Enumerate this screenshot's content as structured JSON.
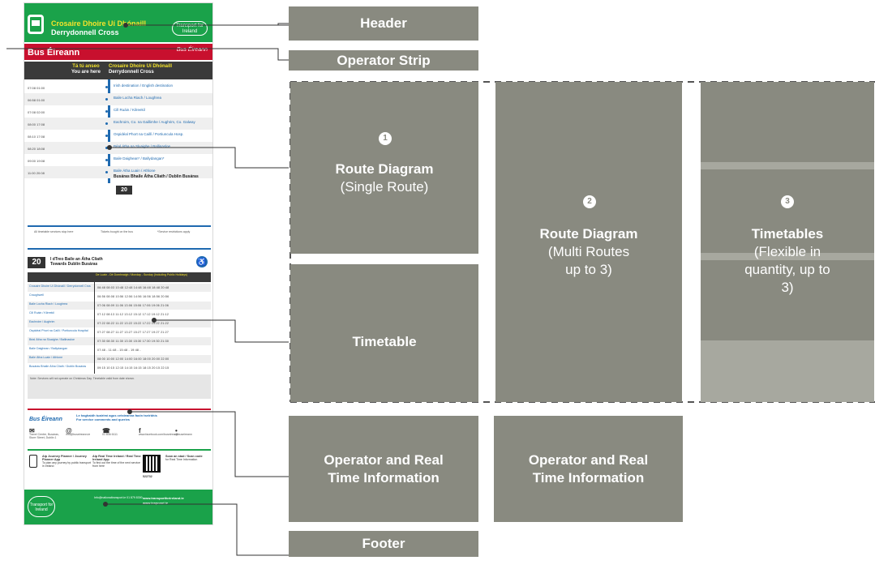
{
  "poster": {
    "stop_name_irish": "Crosaire Dhoire Uí Dhónaill",
    "stop_name_english": "Derrydonnell Cross",
    "tfi_logo": "Transport for Ireland",
    "operator": "Bus Éireann",
    "operator_logo": "Bus Éireann",
    "you_are_here_irish": "Tá tú anseo",
    "you_are_here_english": "You are here",
    "route_stops": [
      {
        "times": "07:08   01:00",
        "name": "Irish destination / English destination"
      },
      {
        "times": "06:58   01:00",
        "name": "Baile Locha Riach / Loughrea"
      },
      {
        "times": "07:08   02:00",
        "name": "Cill Ruáin / Kilreekil"
      },
      {
        "times": "08:00   17:08",
        "name": "Eachroim, Co. na Gaillimhe / Aughrim, Co. Galway"
      },
      {
        "times": "08:10   17:08",
        "name": "Ospidéal Phort na Caillí / Portiuncula Hosp."
      },
      {
        "times": "08:20   18:08",
        "name": "Béal Átha na Sluaighe / Ballinasloe"
      },
      {
        "times": "09:00   19:08",
        "name": "Baile Daighean* / Ballydangan*"
      },
      {
        "times": "11:00   20:08",
        "name": "Baile Átha Luain / Athlone"
      }
    ],
    "destination": "Busáras Bhaile Átha Cliath / Dublin Busáras",
    "route_number": "20",
    "legend_items": [
      "All timetable services stop here",
      "Tickets bought on the bus",
      "*Service restrictions apply"
    ],
    "timetable_destination_irish": "I dTreo Baile an Átha Cliath",
    "timetable_destination_english": "Towards Dublin Busáras",
    "timetable_days": "De Luain - Dé Domhnaigh / Monday - Sunday (Including Public Holidays)",
    "timetable_rows": [
      {
        "stop": "Crosaire Dhoire Uí Dhónaill / Derrydonnell Cross",
        "times": "06:48  08:03  10:48  12:48  14:48  16:48  18:48  20:48"
      },
      {
        "stop": "Craughwell",
        "times": "06:56  08:08  10:56  12:56  14:56  16:56  18:56  20:56"
      },
      {
        "stop": "Baile Locha Riach / Loughrea",
        "times": "07:06  08:09  11:06  13:06  15:06  17:06  19:06  21:06"
      },
      {
        "stop": "Cill Ruáin / Kilreekil",
        "times": "07:12  08:13  11:12  13:12  15:12  17:12  19:12  21:12"
      },
      {
        "stop": "Eachroim / Aughrim",
        "times": "07:22  08:22  11:22  13:22  15:22  17:22  19:22  21:22"
      },
      {
        "stop": "Ospidéal Phort na Caillí / Portiuncula Hospital",
        "times": "07:27  08:27  11:27  13:27  15:27  17:27  19:27  21:27"
      },
      {
        "stop": "Béal Átha na Sluaighe / Ballinasloe",
        "times": "07:30  08:30  11:30  13:30  15:30  17:30  19:30  21:30"
      },
      {
        "stop": "Baile Daighean / Ballydangan",
        "times": "07:48    -    11:48    -    15:48    -    19:48    -"
      },
      {
        "stop": "Baile Átha Luain / Athlone",
        "times": "08:00  10:00  12:00  14:00  16:00  18:00  20:00  22:00"
      },
      {
        "stop": "Busáras Bhaile Átha Cliath / Dublin Busáras",
        "times": "09:15  10:15  12:15  14:15  16:15  18:15  20:15  22:15"
      }
    ],
    "timetable_notes": "Note: Services will not operate on Christmas Day. Timetable valid from date shown.",
    "comments_irish": "Le haghaidh tuairimí agus ceisteanna faoin tseirbhís",
    "comments_english": "For service comments and queries",
    "contacts": [
      {
        "icon": "letter",
        "text": "Travel Centre, Busáras, Store Street, Dublin 1"
      },
      {
        "icon": "@",
        "text": "info@buseireann.ie"
      },
      {
        "icon": "phone",
        "text": "01 836 6111"
      },
      {
        "icon": "f",
        "text": "www.facebook.com/buseireann"
      },
      {
        "icon": "bird",
        "text": "@buseireann"
      }
    ],
    "apps": [
      {
        "title": "Aip Journey Planner / Journey Planner App",
        "text": "To plan any journey by public transport in Ireland"
      },
      {
        "title": "Aip Real Time Ireland / Real Time Ireland App",
        "text": "To find out the time of the next service from here"
      },
      {
        "title": "Scan an stad / Scan code",
        "text": "for Real Time Information"
      }
    ],
    "stop_code": "522732",
    "footer_web1": "www.transportforireland.ie",
    "footer_web2": "www.leapcard.ie",
    "footer_mid": "Info@nationaltransport.ie  01 879 8300"
  },
  "labels": {
    "header": "Header",
    "operator_strip": "Operator Strip",
    "route_single_title": "Route Diagram",
    "route_single_sub": "(Single Route)",
    "route_multi_title": "Route Diagram",
    "route_multi_sub": "(Multi Routes up to 3)",
    "timetable": "Timetable",
    "timetables_title": "Timetables",
    "timetables_sub": "(Flexible in quantity, up to 3)",
    "operator_rti_1": "Operator and Real Time Information",
    "operator_rti_2": "Operator and Real Time Information",
    "footer": "Footer",
    "num1": "1",
    "num2": "2",
    "num3": "3"
  },
  "colors": {
    "label_bg": "#898a80",
    "tfi_green": "#1aa24a",
    "bus_eireann_red": "#c8102e",
    "route_blue": "#1f6ab0"
  }
}
